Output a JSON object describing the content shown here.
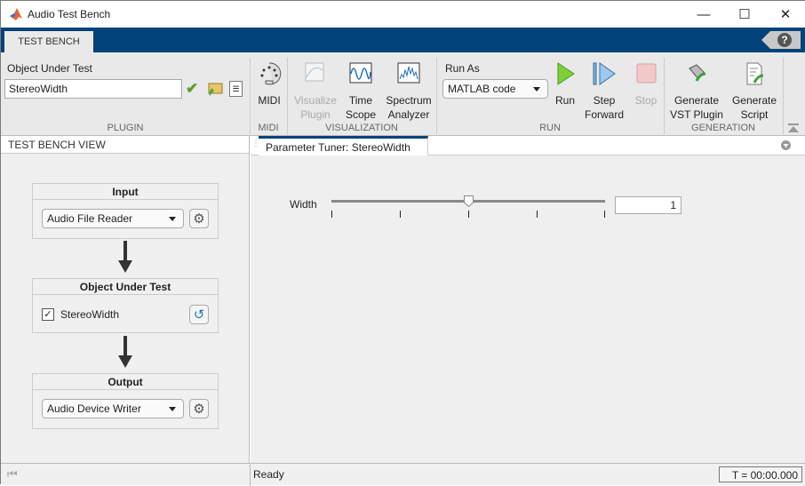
{
  "window": {
    "title": "Audio Test Bench",
    "minimize": "—",
    "maximize": "☐",
    "close": "✕"
  },
  "tabs": [
    "TEST BENCH"
  ],
  "help": "?",
  "ribbon": {
    "plugin": {
      "label": "Object Under Test",
      "value": "StereoWidth",
      "group": "PLUGIN"
    },
    "midi": {
      "label": "MIDI",
      "group": "MIDI"
    },
    "visualization": {
      "visualize_l1": "Visualize",
      "visualize_l2": "Plugin",
      "time_l1": "Time",
      "time_l2": "Scope",
      "spec_l1": "Spectrum",
      "spec_l2": "Analyzer",
      "group": "VISUALIZATION"
    },
    "run": {
      "run_as_label": "Run As",
      "run_as_value": "MATLAB code",
      "run": "Run",
      "step_l1": "Step",
      "step_l2": "Forward",
      "stop": "Stop",
      "group": "RUN"
    },
    "generation": {
      "vst_l1": "Generate",
      "vst_l2": "VST Plugin",
      "script_l1": "Generate",
      "script_l2": "Script",
      "group": "GENERATION"
    }
  },
  "left": {
    "header": "TEST BENCH VIEW",
    "input": {
      "title": "Input",
      "value": "Audio File Reader"
    },
    "out": {
      "title": "Object Under Test",
      "checkbox_label": "StereoWidth",
      "checked": true
    },
    "output": {
      "title": "Output",
      "value": "Audio Device Writer"
    }
  },
  "right": {
    "tab": "Parameter Tuner: StereoWidth",
    "param": {
      "label": "Width",
      "value": "1",
      "slider_fraction": 0.5
    }
  },
  "status": {
    "text": "Ready",
    "time": "T = 00:00.000"
  }
}
